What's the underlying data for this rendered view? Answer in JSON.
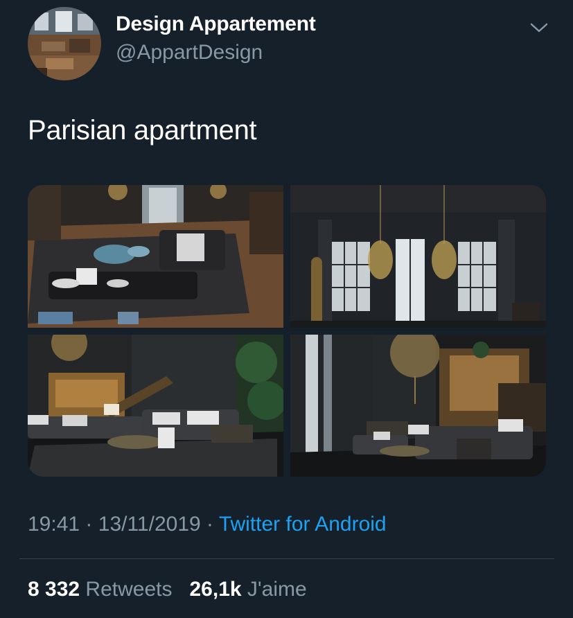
{
  "user": {
    "display_name": "Design Appartement",
    "handle": "@AppartDesign",
    "avatar_icon": "avatar-photo-icon"
  },
  "tweet": {
    "text": "Parisian apartment",
    "time": "19:41",
    "date": "13/11/2019",
    "separator": "·",
    "source": "Twitter for Android"
  },
  "stats": {
    "retweets_count": "8 332",
    "retweets_label": "Retweets",
    "likes_count": "26,1k",
    "likes_label": "J'aime"
  },
  "colors": {
    "background": "#15202b",
    "text_primary": "#ffffff",
    "text_secondary": "#8899a6",
    "link": "#1da1f2",
    "divider": "#38444d"
  },
  "media": {
    "count": 4
  }
}
